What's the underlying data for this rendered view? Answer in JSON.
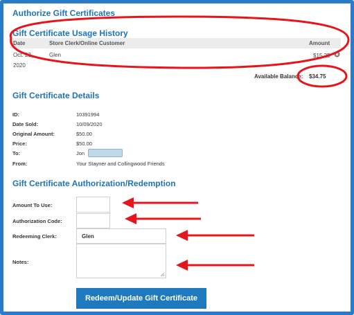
{
  "page_title": "Authorize Gift Certificates",
  "history": {
    "title": "Gift Certificate Usage History",
    "columns": {
      "date": "Date",
      "clerk": "Store Clerk/Online Customer",
      "amount": "Amount"
    },
    "rows": [
      {
        "date_line1": "Oct. 23,",
        "date_line2": "2020",
        "clerk": "Glen",
        "amount": "$15.25"
      }
    ],
    "balance_label": "Available Balance:",
    "balance_value": "$34.75"
  },
  "details": {
    "title": "Gift Certificate Details",
    "id_label": "ID:",
    "id_value": "10391994",
    "sold_label": "Date Sold:",
    "sold_value": "10/09/2020",
    "orig_label": "Original Amount:",
    "orig_value": "$50.00",
    "price_label": "Price:",
    "price_value": "$50.00",
    "to_label": "To:",
    "to_value": "Jon",
    "from_label": "From:",
    "from_value": "Your Stayner and Collingwood Friends"
  },
  "auth": {
    "title": "Gift Certificate Authorization/Redemption",
    "amount_label": "Amount To Use:",
    "code_label": "Authorization Code:",
    "clerk_label": "Redeeming Clerk:",
    "clerk_value": "Glen",
    "notes_label": "Notes:",
    "button_label": "Redeem/Update Gift Certificate"
  },
  "colors": {
    "accent": "#1e74b9",
    "button": "#1e79bf",
    "annotation": "#e8141b"
  },
  "icons": {
    "delete": "delete-icon"
  }
}
